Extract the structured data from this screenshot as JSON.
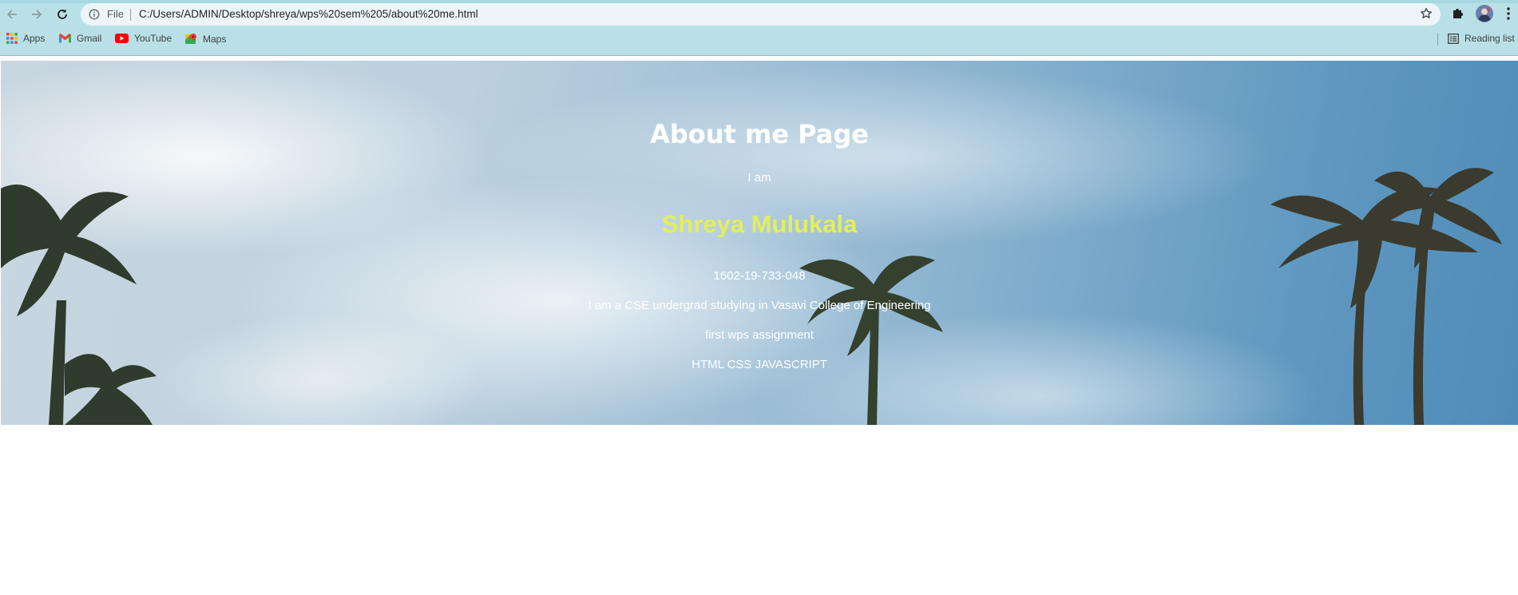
{
  "browser": {
    "omnibox": {
      "scheme_label": "File",
      "url": "C:/Users/ADMIN/Desktop/shreya/wps%20sem%205/about%20me.html"
    },
    "bookmarks": [
      {
        "label": "Apps",
        "icon": "apps-grid-icon"
      },
      {
        "label": "Gmail",
        "icon": "gmail-icon"
      },
      {
        "label": "YouTube",
        "icon": "youtube-icon"
      },
      {
        "label": "Maps",
        "icon": "maps-icon"
      }
    ],
    "reading_list_label": "Reading list"
  },
  "page": {
    "title": "About me Page",
    "intro": "I am",
    "name": "Shreya Mulukala",
    "roll_number": "1602-19-733-048",
    "description": "I am a CSE undergrad studying in Vasavi College of Engineering",
    "assignment": "first wps assignment",
    "skills": "HTML CSS JAVASCRIPT"
  },
  "colors": {
    "chrome_bg": "#b9e0e6",
    "name_color": "#e3ef5c",
    "text_color": "#ffffff"
  }
}
